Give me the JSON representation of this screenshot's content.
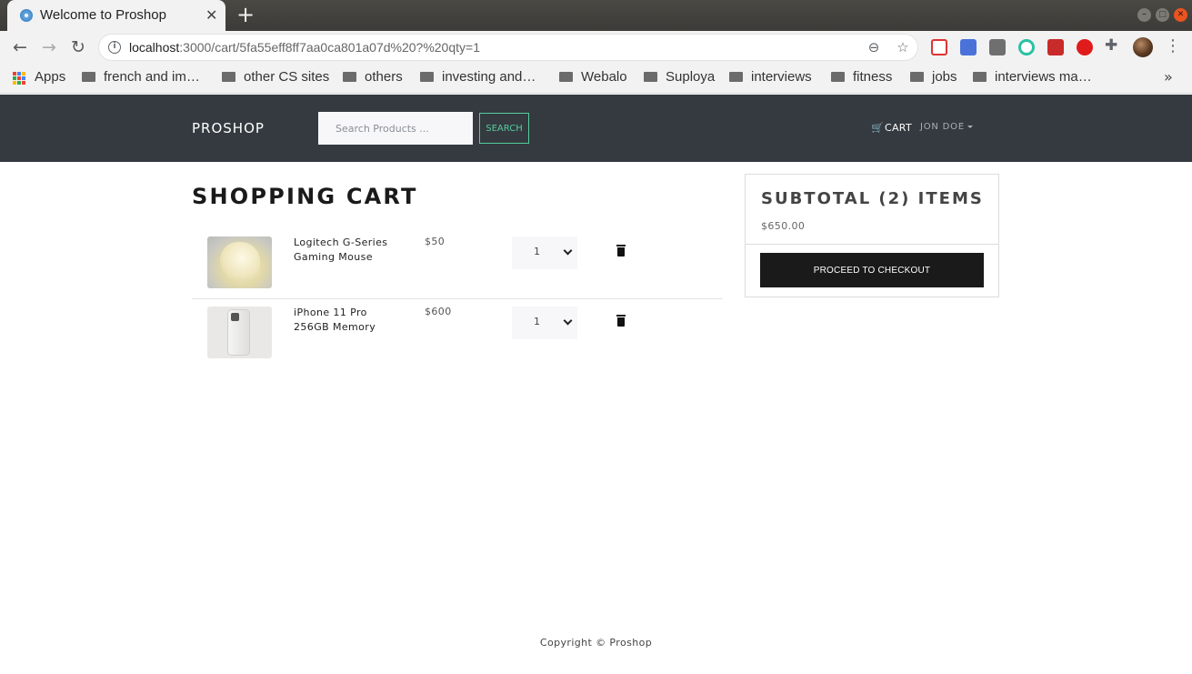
{
  "browser": {
    "tab_title": "Welcome to Proshop",
    "tab_close": "✕",
    "new_tab": "+",
    "url_host": "localhost",
    "url_rest": ":3000/cart/5fa55eff8ff7aa0ca801a07d%20?%20qty=1",
    "bookmarks": [
      {
        "label": "Apps",
        "type": "apps"
      },
      {
        "label": "french and im…",
        "type": "folder"
      },
      {
        "label": "other CS sites",
        "type": "folder"
      },
      {
        "label": "others",
        "type": "folder"
      },
      {
        "label": "investing and…",
        "type": "folder"
      },
      {
        "label": "Webalo",
        "type": "folder"
      },
      {
        "label": "Suploya",
        "type": "folder"
      },
      {
        "label": "interviews",
        "type": "folder"
      },
      {
        "label": "fitness",
        "type": "folder"
      },
      {
        "label": "jobs",
        "type": "folder"
      },
      {
        "label": "interviews ma…",
        "type": "folder"
      }
    ],
    "bookmarks_overflow": "»",
    "nav_icons": [
      "back-arrow-icon",
      "forward-arrow-icon",
      "reload-icon"
    ],
    "omnibox_icons": [
      "zoom-icon",
      "bookmark-star-icon"
    ],
    "extension_icons": [
      "red-cross-extension-icon",
      "translate-extension-icon",
      "grey-extension-icon",
      "green-circle-extension-icon",
      "red-square-extension-icon",
      "red-hand-extension-icon",
      "puzzle-extensions-icon",
      "profile-avatar-icon",
      "kebab-menu-icon"
    ]
  },
  "navbar": {
    "brand": "PROSHOP",
    "search_placeholder": "Search Products ...",
    "search_button": "SEARCH",
    "cart_label": "CART",
    "user_label": "JON DOE"
  },
  "cart": {
    "title": "SHOPPING CART",
    "items": [
      {
        "name": "Logitech G-Series Gaming Mouse",
        "price": "$50",
        "qty": "1",
        "image": "gaming-mouse-image"
      },
      {
        "name": "iPhone 11 Pro 256GB Memory",
        "price": "$600",
        "qty": "1",
        "image": "iphone-image"
      }
    ]
  },
  "summary": {
    "title": "SUBTOTAL (2) ITEMS",
    "total": "$650.00",
    "checkout_button": "PROCEED TO CHECKOUT"
  },
  "footer": {
    "copyright": "Copyright © Proshop"
  },
  "colors": {
    "navbar_bg": "#343a40",
    "accent": "#56cc9d",
    "checkout_bg": "#1a1a1a"
  }
}
